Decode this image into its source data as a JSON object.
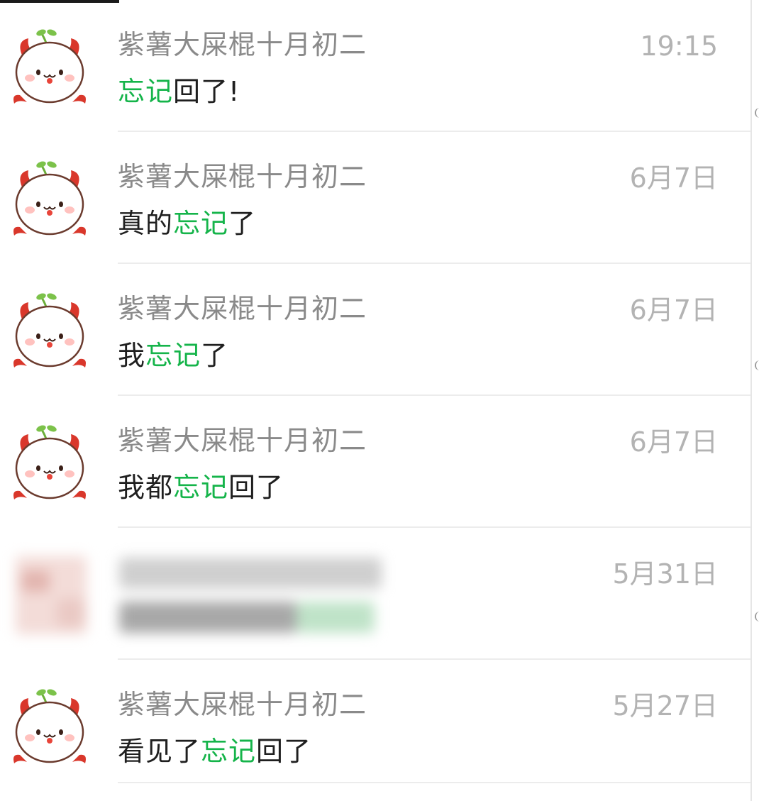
{
  "conversations": [
    {
      "name": "紫薯大屎棍十月初二",
      "time": "19:15",
      "message": [
        {
          "text": "忘记",
          "highlight": true
        },
        {
          "text": "回了!",
          "highlight": false
        }
      ]
    },
    {
      "name": "紫薯大屎棍十月初二",
      "time": "6月7日",
      "message": [
        {
          "text": "真的",
          "highlight": false
        },
        {
          "text": "忘记",
          "highlight": true
        },
        {
          "text": "了",
          "highlight": false
        }
      ]
    },
    {
      "name": "紫薯大屎棍十月初二",
      "time": "6月7日",
      "message": [
        {
          "text": "我",
          "highlight": false
        },
        {
          "text": "忘记",
          "highlight": true
        },
        {
          "text": "了",
          "highlight": false
        }
      ]
    },
    {
      "name": "紫薯大屎棍十月初二",
      "time": "6月7日",
      "message": [
        {
          "text": "我都",
          "highlight": false
        },
        {
          "text": "忘记",
          "highlight": true
        },
        {
          "text": "回了",
          "highlight": false
        }
      ]
    },
    {
      "name": "",
      "time": "5月31日",
      "blurred": true,
      "message": []
    },
    {
      "name": "紫薯大屎棍十月初二",
      "time": "5月27日",
      "message": [
        {
          "text": "看见了",
          "highlight": false
        },
        {
          "text": "忘记",
          "highlight": true
        },
        {
          "text": "回了",
          "highlight": false
        }
      ]
    }
  ],
  "colors": {
    "highlight": "#15b44a",
    "name": "#8a8a8a",
    "time": "#b3b3b3",
    "message": "#1f1f1f",
    "avatar_horn": "#d9372b",
    "avatar_sprout": "#6cae3a"
  },
  "icons": {
    "avatar": "devil-cat-avatar-icon"
  }
}
